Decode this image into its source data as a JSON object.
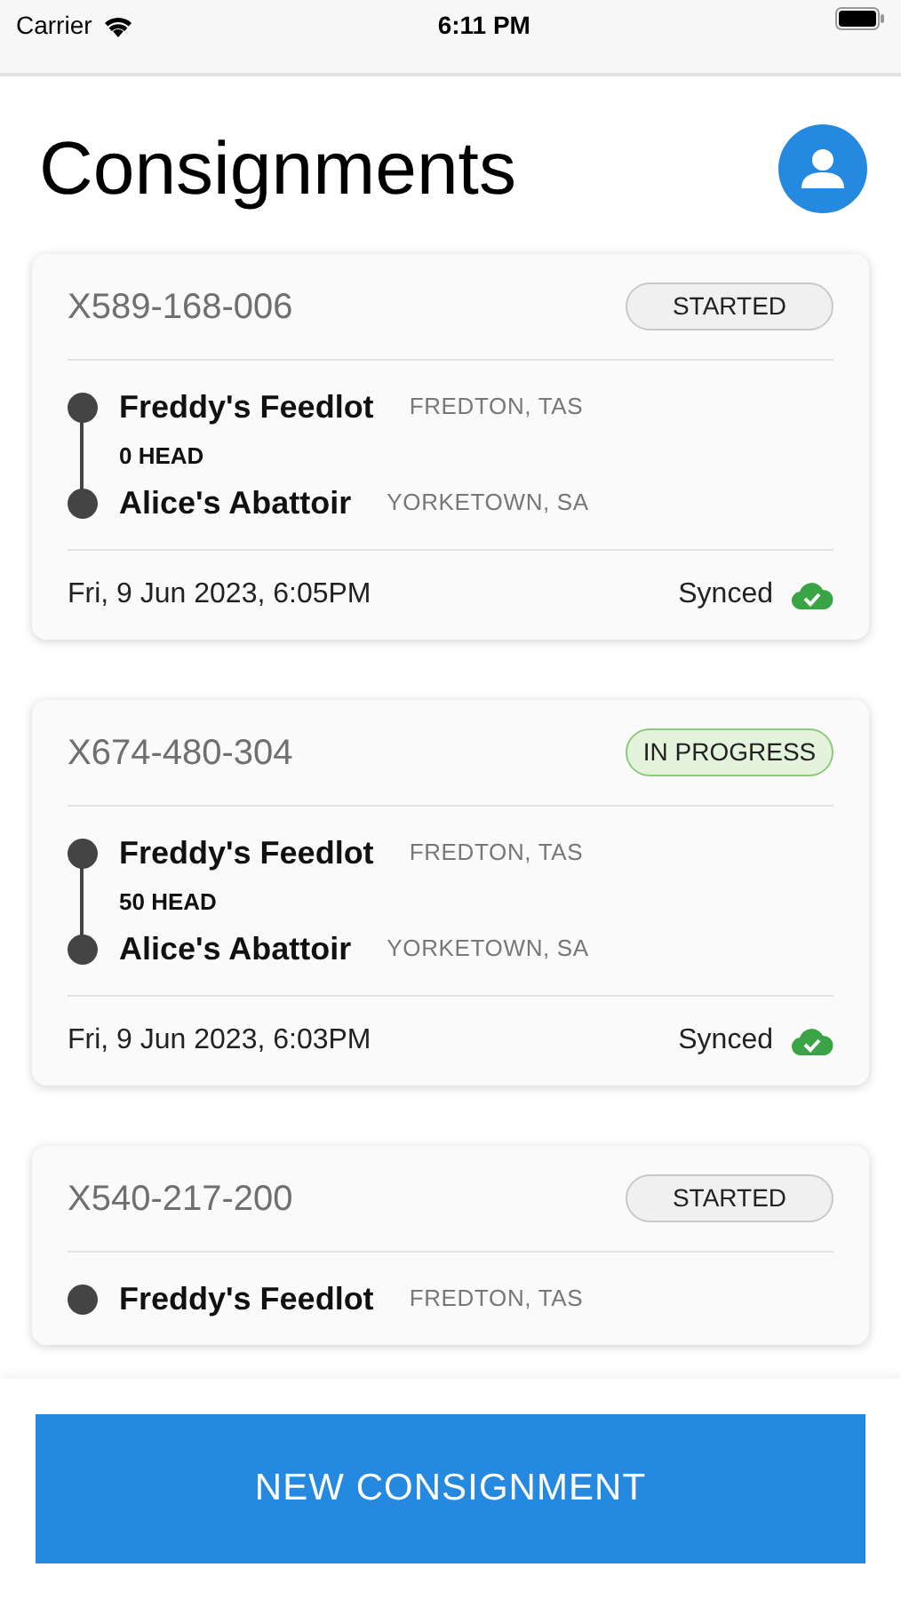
{
  "status_bar": {
    "carrier": "Carrier",
    "time": "6:11 PM"
  },
  "header": {
    "title": "Consignments"
  },
  "consignments": [
    {
      "id": "X589-168-006",
      "status": {
        "label": "STARTED",
        "kind": "started"
      },
      "origin": {
        "name": "Freddy's Feedlot",
        "place": "FREDTON, TAS"
      },
      "head": "0 HEAD",
      "destination": {
        "name": "Alice's Abattoir",
        "place": "YORKETOWN, SA"
      },
      "date": "Fri, 9 Jun 2023, 6:05PM",
      "sync": "Synced"
    },
    {
      "id": "X674-480-304",
      "status": {
        "label": "IN PROGRESS",
        "kind": "in_progress"
      },
      "origin": {
        "name": "Freddy's Feedlot",
        "place": "FREDTON, TAS"
      },
      "head": "50 HEAD",
      "destination": {
        "name": "Alice's Abattoir",
        "place": "YORKETOWN, SA"
      },
      "date": "Fri, 9 Jun 2023, 6:03PM",
      "sync": "Synced"
    },
    {
      "id": "X540-217-200",
      "status": {
        "label": "STARTED",
        "kind": "started"
      },
      "origin": {
        "name": "Freddy's Feedlot",
        "place": "FREDTON, TAS"
      }
    }
  ],
  "new_button": "NEW CONSIGNMENT"
}
